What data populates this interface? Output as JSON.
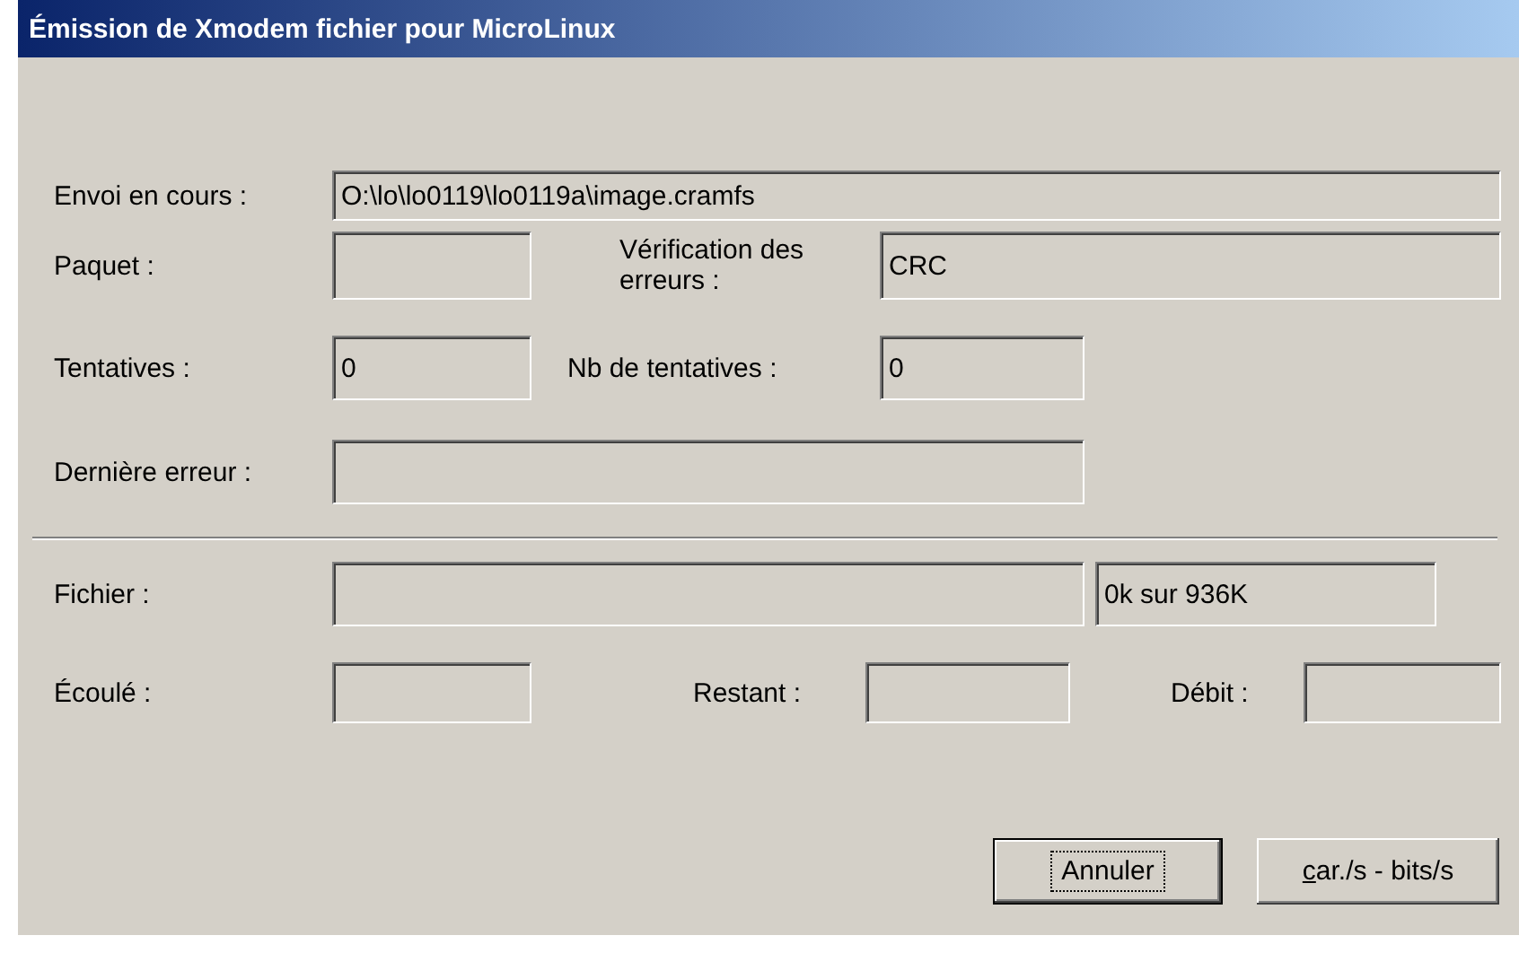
{
  "window": {
    "title": "Émission de Xmodem fichier pour MicroLinux"
  },
  "rows": [
    {
      "kind": "fields",
      "items": [
        {
          "kind": "label",
          "text": "Envoi en cours :"
        },
        {
          "kind": "field",
          "value": "O:\\lo\\lo0119\\lo0119a\\image.cramfs"
        }
      ]
    },
    {
      "kind": "fields",
      "items": [
        {
          "kind": "label",
          "text": "Paquet :"
        },
        {
          "kind": "field"
        },
        {
          "kind": "label",
          "text": "Vérification des erreurs :"
        },
        {
          "kind": "field",
          "value": "CRC"
        }
      ]
    },
    {
      "kind": "fields",
      "items": [
        {
          "kind": "label",
          "text": "Tentatives :"
        },
        {
          "kind": "field",
          "value": "0"
        },
        {
          "kind": "label",
          "text": "Nb de tentatives :"
        },
        {
          "kind": "field",
          "value": "0"
        }
      ]
    },
    {
      "kind": "fields",
      "items": [
        {
          "kind": "label",
          "text": "Dernière erreur :"
        },
        {
          "kind": "field"
        }
      ]
    },
    {
      "kind": "divider"
    },
    {
      "kind": "fields",
      "items": [
        {
          "kind": "label",
          "text": "Fichier :"
        },
        {
          "kind": "field"
        },
        {
          "kind": "field",
          "value": "0k sur 936K"
        }
      ]
    },
    {
      "kind": "fields",
      "items": [
        {
          "kind": "label",
          "text": "Écoulé :"
        },
        {
          "kind": "field"
        },
        {
          "kind": "label",
          "text": "Restant :"
        },
        {
          "kind": "field"
        },
        {
          "kind": "label",
          "text": "Débit :"
        },
        {
          "kind": "field"
        }
      ]
    }
  ],
  "buttons": [
    {
      "label": "Annuler",
      "default": true,
      "focused": true
    },
    {
      "label": "car./s - bits/s",
      "default": false,
      "focused": false,
      "underline_first_letter": true
    }
  ]
}
